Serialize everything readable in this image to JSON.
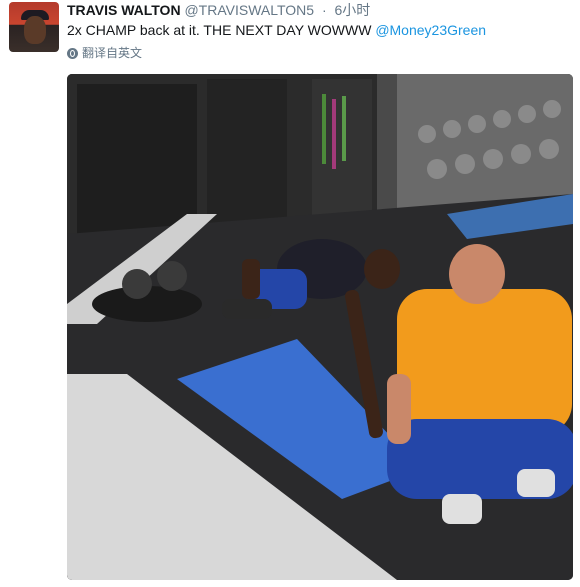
{
  "tweet": {
    "author_name": "TRAVIS WALTON",
    "handle": "@TRAVISWALTON5",
    "separator": "·",
    "time": "6小时",
    "text": "2x CHAMP back at it. THE NEXT DAY WOWWW ",
    "mention": "@Money23Green",
    "translate_label": "翻译自英文"
  },
  "icons": {
    "translate": "globe-icon"
  },
  "colors": {
    "link": "#1b95e0",
    "muted": "#657786",
    "mat": "#3a6fd0",
    "shirt": "#f29b1c"
  }
}
